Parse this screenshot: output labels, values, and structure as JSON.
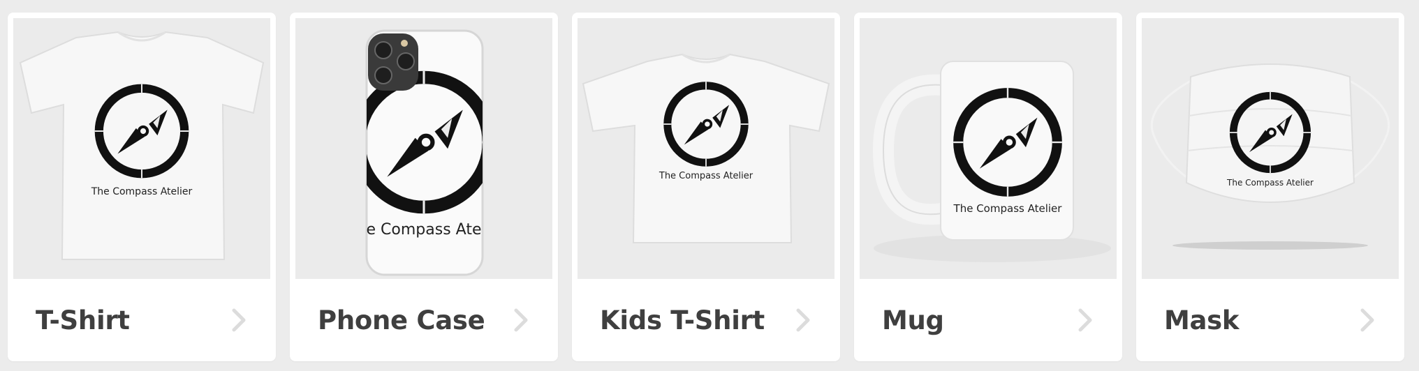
{
  "products": [
    {
      "name": "T-Shirt",
      "design_text": "The Compass Atelier",
      "chevron": "chevron-right-icon"
    },
    {
      "name": "Phone Case",
      "design_text": "e Compass Ate",
      "chevron": "chevron-right-icon"
    },
    {
      "name": "Kids T-Shirt",
      "design_text": "The Compass Atelier",
      "chevron": "chevron-right-icon"
    },
    {
      "name": "Mug",
      "design_text": "The Compass Atelier",
      "chevron": "chevron-right-icon"
    },
    {
      "name": "Mask",
      "design_text": "The Compass Atelier",
      "chevron": "chevron-right-icon"
    }
  ],
  "colors": {
    "background": "#ececec",
    "card": "#ffffff",
    "image_well": "#ebebeb",
    "label_text": "#3f3f3f",
    "chevron": "#dcdcdc",
    "logo": "#111111"
  }
}
